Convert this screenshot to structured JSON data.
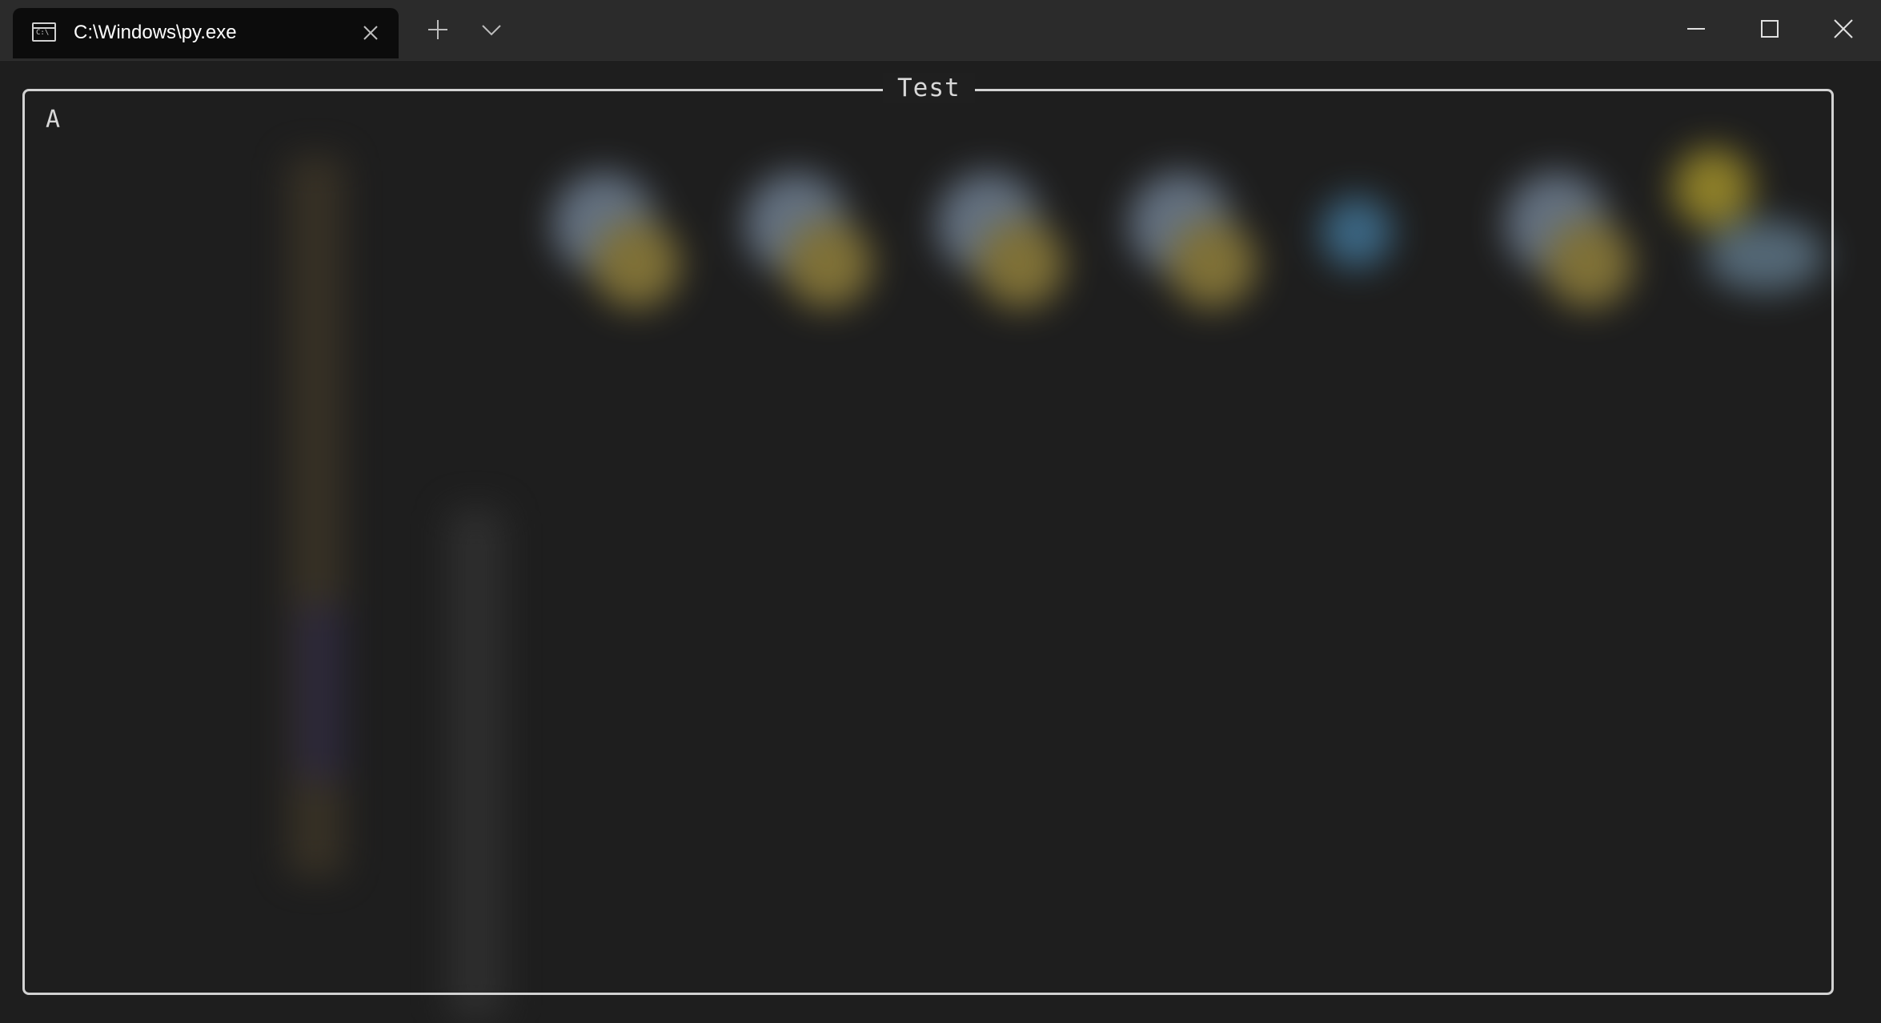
{
  "window": {
    "tab_title": "C:\\Windows\\py.exe",
    "tab_icon_text": "C:\\",
    "icons": {
      "tab": "console-icon",
      "close_tab": "close-icon",
      "new_tab": "plus-icon",
      "dropdown": "chevron-down-icon",
      "minimize": "minimize-icon",
      "maximize": "maximize-icon",
      "close_window": "close-icon"
    }
  },
  "terminal": {
    "panel_title": "Test",
    "lines": [
      "A"
    ]
  },
  "colors": {
    "titlebar": "#2b2b2b",
    "tab_active": "#0c0c0c",
    "terminal_bg": "#1f1f1f",
    "frame_border": "#d2d2d2",
    "text": "#d8d8d8"
  }
}
